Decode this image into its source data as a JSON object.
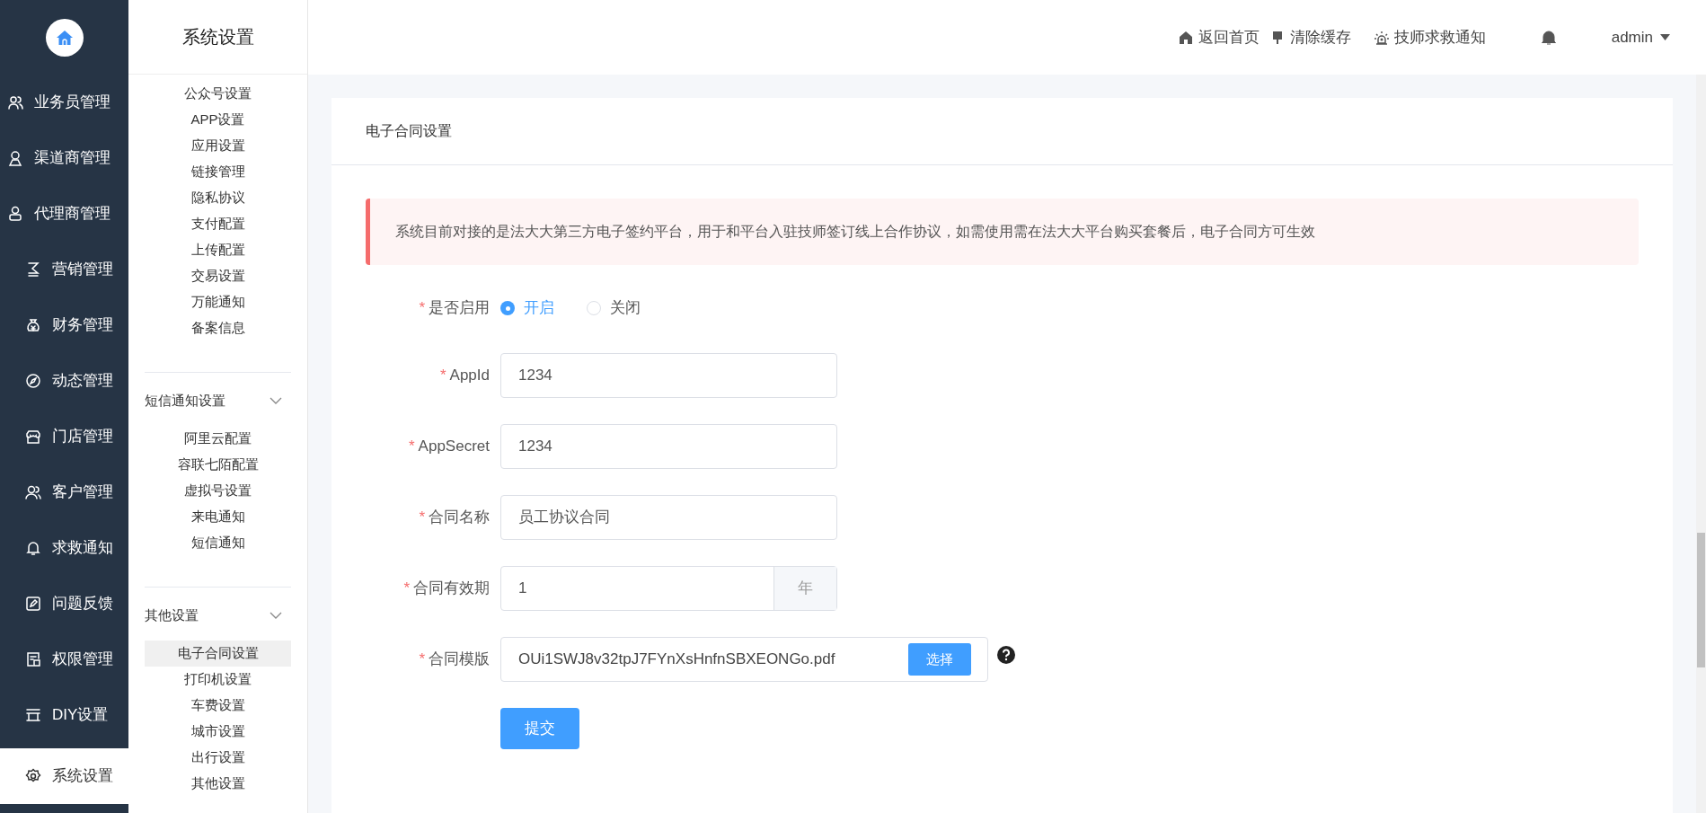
{
  "nav": {
    "items": [
      {
        "label": "业务员管理",
        "selected": false
      },
      {
        "label": "渠道商管理",
        "selected": false
      },
      {
        "label": "代理商管理",
        "selected": false
      },
      {
        "label": "营销管理",
        "selected": false
      },
      {
        "label": "财务管理",
        "selected": false
      },
      {
        "label": "动态管理",
        "selected": false
      },
      {
        "label": "门店管理",
        "selected": false
      },
      {
        "label": "客户管理",
        "selected": false
      },
      {
        "label": "求救通知",
        "selected": false
      },
      {
        "label": "问题反馈",
        "selected": false
      },
      {
        "label": "权限管理",
        "selected": false
      },
      {
        "label": "DIY设置",
        "selected": false
      },
      {
        "label": "系统设置",
        "selected": true
      }
    ]
  },
  "submenu": {
    "title": "系统设置",
    "groups": [
      {
        "items": [
          {
            "label": "公众号设置",
            "selected": false
          },
          {
            "label": "APP设置",
            "selected": false
          },
          {
            "label": "应用设置",
            "selected": false
          },
          {
            "label": "链接管理",
            "selected": false
          },
          {
            "label": "隐私协议",
            "selected": false
          },
          {
            "label": "支付配置",
            "selected": false
          },
          {
            "label": "上传配置",
            "selected": false
          },
          {
            "label": "交易设置",
            "selected": false
          },
          {
            "label": "万能通知",
            "selected": false
          },
          {
            "label": "备案信息",
            "selected": false
          }
        ]
      },
      {
        "title": "短信通知设置",
        "expanded": true,
        "items": [
          {
            "label": "阿里云配置",
            "selected": false
          },
          {
            "label": "容联七陌配置",
            "selected": false
          },
          {
            "label": "虚拟号设置",
            "selected": false
          },
          {
            "label": "来电通知",
            "selected": false
          },
          {
            "label": "短信通知",
            "selected": false
          }
        ]
      },
      {
        "title": "其他设置",
        "expanded": true,
        "items": [
          {
            "label": "电子合同设置",
            "selected": true
          },
          {
            "label": "打印机设置",
            "selected": false
          },
          {
            "label": "车费设置",
            "selected": false
          },
          {
            "label": "城市设置",
            "selected": false
          },
          {
            "label": "出行设置",
            "selected": false
          },
          {
            "label": "其他设置",
            "selected": false
          }
        ]
      }
    ]
  },
  "header": {
    "links": [
      "返回首页",
      "清除缓存",
      "技师求救通知"
    ],
    "user": "admin"
  },
  "card": {
    "title": "电子合同设置",
    "alert": "系统目前对接的是法大大第三方电子签约平台，用于和平台入驻技师签订线上合作协议，如需使用需在法大大平台购买套餐后，电子合同方可生效",
    "fields": [
      {
        "kind": "radio",
        "label": "是否启用",
        "required_mark": "*",
        "options": [
          {
            "label": "开启",
            "selected": true
          },
          {
            "label": "关闭",
            "selected": false
          }
        ]
      },
      {
        "kind": "text",
        "label": "AppId",
        "required_mark": "*",
        "value": "1234"
      },
      {
        "kind": "text",
        "label": "AppSecret",
        "required_mark": "*",
        "value": "1234"
      },
      {
        "kind": "text",
        "label": "合同名称",
        "required_mark": "*",
        "value": "员工协议合同"
      },
      {
        "kind": "suffix",
        "label": "合同有效期",
        "required_mark": "*",
        "value": "1",
        "suffix": "年"
      },
      {
        "kind": "file",
        "label": "合同模版",
        "required_mark": "*",
        "value": "OUi1SWJ8v32tpJ7FYnXsHnfnSBXEONGo.pdf",
        "button": "选择"
      }
    ],
    "submit": "提交"
  }
}
